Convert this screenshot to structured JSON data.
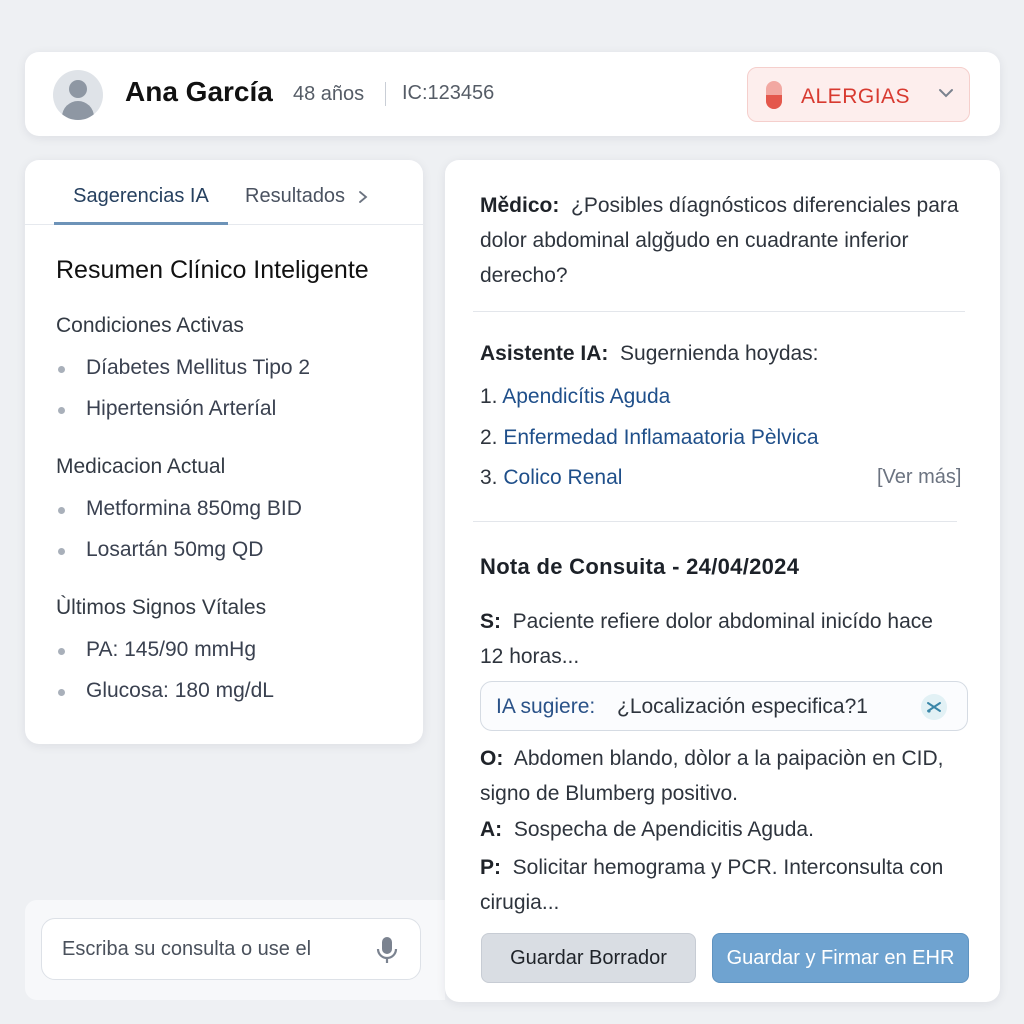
{
  "colors": {
    "accent": "#6fa3d0",
    "allergy_red": "#d83a30",
    "link_blue": "#1f4f8a"
  },
  "header": {
    "avatar_icon": "user-avatar-icon",
    "patient_name": "Ana García",
    "age": "48 años",
    "id": "IC:123456",
    "allergy_label": "ALERGIAS",
    "allergy_icon": "pill-icon"
  },
  "tabs": {
    "active": "Sagerencias IA",
    "other": "Resultados"
  },
  "summary": {
    "title": "Resumen Clínico Inteligente",
    "sections": [
      {
        "title": "Condiciones Activas",
        "items": [
          "Díabetes Mellitus Tipo 2",
          "Hipertensión Arteríal"
        ]
      },
      {
        "title": "Medicacion Actual",
        "items": [
          "Metformina 850mg BID",
          "Losartán 50mg QD"
        ]
      },
      {
        "title": "Ùltimos Signos Vítales",
        "items": [
          "PA: 145/90 mmHg",
          "Glucosa: 180 mg/dL"
        ]
      }
    ]
  },
  "query": {
    "placeholder": "Escriba su consulta o use el",
    "mic_icon": "microphone-icon"
  },
  "chat": {
    "doctor_label": "Mědico:",
    "doctor_text": "¿Posibles díagnósticos diferenciales para dolor abdominal algğudo en cuadrante inferior derecho?",
    "ai_label": "Asistente IA:",
    "ai_text": "Sugernienda hoydas:",
    "diagnoses": [
      {
        "num": "1.",
        "text": "Apendicítis Aguda"
      },
      {
        "num": "2.",
        "text": "Enfermedad Inflamaatoria Pèlvica"
      },
      {
        "num": "3.",
        "text": "Colico Renal"
      }
    ],
    "ver_mas": "[Ver más]"
  },
  "note": {
    "title": "Nota de Consuita - 24/04/2024",
    "s_label": "S:",
    "s_text": "Paciente refiere dolor abdominal inicído hace 12 horas...",
    "ai_suggest_label": "IA sugiere:",
    "ai_suggest_text": "¿Localización especifica?1",
    "o_label": "O:",
    "o_text": "Abdomen blando, dòlor a la paipaciòn en CID, signo de Blumberg positivo.",
    "a_label": "A:",
    "a_text": "Sospecha de Apendicitis Aguda.",
    "p_label": "P:",
    "p_text": "Solicitar hemograma y PCR. Interconsulta con cirugia..."
  },
  "buttons": {
    "draft": "Guardar Borrador",
    "sign": "Guardar y Firmar en EHR"
  }
}
